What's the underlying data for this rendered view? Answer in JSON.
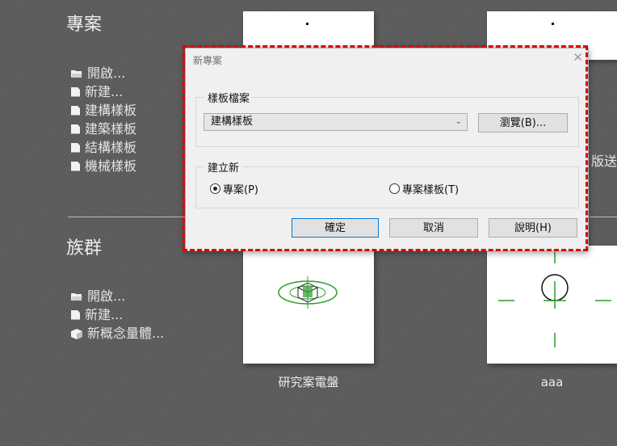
{
  "project": {
    "title": "專案",
    "items": [
      {
        "label": "開啟...",
        "icon": "folder-icon"
      },
      {
        "label": "新建...",
        "icon": "new-doc-icon"
      },
      {
        "label": "建構樣板",
        "icon": "doc-icon"
      },
      {
        "label": "建築樣板",
        "icon": "doc-icon"
      },
      {
        "label": "結構樣板",
        "icon": "doc-icon"
      },
      {
        "label": "機械樣板",
        "icon": "doc-icon"
      }
    ]
  },
  "family": {
    "title": "族群",
    "items": [
      {
        "label": "開啟...",
        "icon": "folder-icon"
      },
      {
        "label": "新建...",
        "icon": "new-doc-icon"
      },
      {
        "label": "新概念量體...",
        "icon": "cube-icon"
      }
    ]
  },
  "cards": [
    {
      "label": "研究案電盤"
    },
    {
      "label": "aaa"
    }
  ],
  "background_fragment": "版送",
  "dialog": {
    "title": "新專案",
    "template_group_label": "樣板檔案",
    "template_selected": "建構樣板",
    "browse_label": "瀏覽(B)...",
    "create_group_label": "建立新",
    "radio_project": "專案(P)",
    "radio_template": "專案樣板(T)",
    "ok_label": "確定",
    "cancel_label": "取消",
    "help_label": "說明(H)"
  },
  "colors": {
    "highlight": "#e00000",
    "accent_green": "#2a9d2a"
  }
}
